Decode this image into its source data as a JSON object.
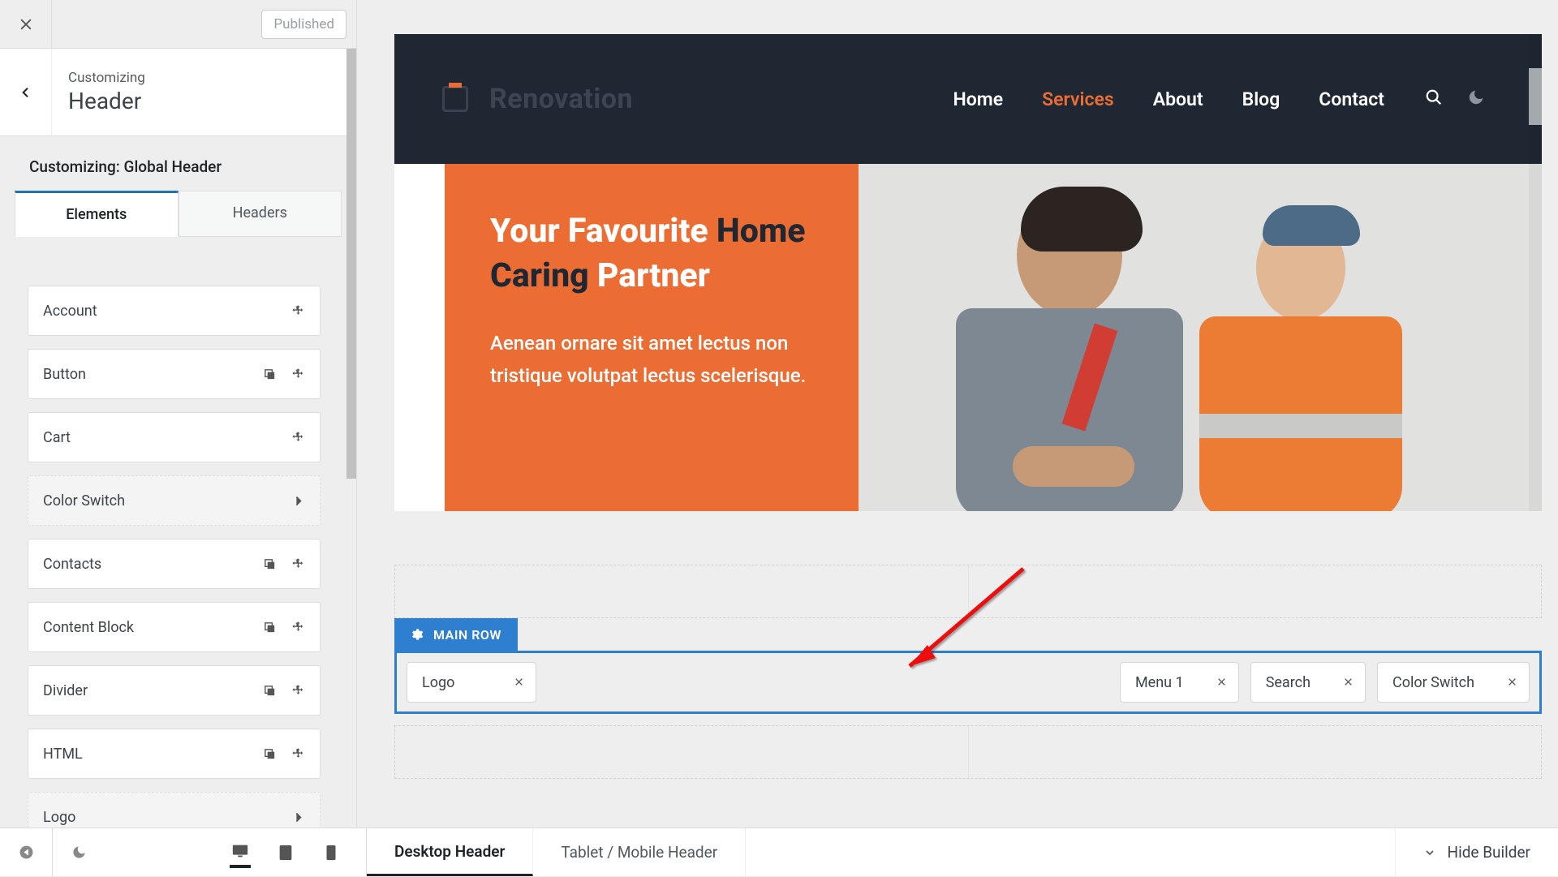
{
  "sidebar": {
    "published_label": "Published",
    "eyebrow": "Customizing",
    "title": "Header",
    "sub_label": "Customizing: Global Header",
    "tabs": {
      "elements": "Elements",
      "headers": "Headers"
    },
    "elements": [
      {
        "label": "Account",
        "style": "move"
      },
      {
        "label": "Button",
        "style": "dup_move"
      },
      {
        "label": "Cart",
        "style": "move"
      },
      {
        "label": "Color Switch",
        "style": "chevron_dashed"
      },
      {
        "label": "Contacts",
        "style": "dup_move"
      },
      {
        "label": "Content Block",
        "style": "dup_move"
      },
      {
        "label": "Divider",
        "style": "dup_move"
      },
      {
        "label": "HTML",
        "style": "dup_move"
      },
      {
        "label": "Logo",
        "style": "chevron_dashed"
      }
    ]
  },
  "preview": {
    "brand": "Renovation",
    "nav": {
      "home": "Home",
      "services": "Services",
      "about": "About",
      "blog": "Blog",
      "contact": "Contact"
    },
    "hero": {
      "title_1": "Your Favourite ",
      "title_2_dark": "Home",
      "title_3_dark": "Caring ",
      "title_4": "Partner",
      "desc": "Aenean ornare sit amet lectus non tristique volutpat lectus scelerisque."
    }
  },
  "builder": {
    "main_row_label": "MAIN ROW",
    "chips": {
      "logo": "Logo",
      "menu1": "Menu 1",
      "search": "Search",
      "color_switch": "Color Switch"
    }
  },
  "bottombar": {
    "tab_desktop": "Desktop Header",
    "tab_mobile": "Tablet / Mobile Header",
    "hide_builder": "Hide Builder"
  }
}
